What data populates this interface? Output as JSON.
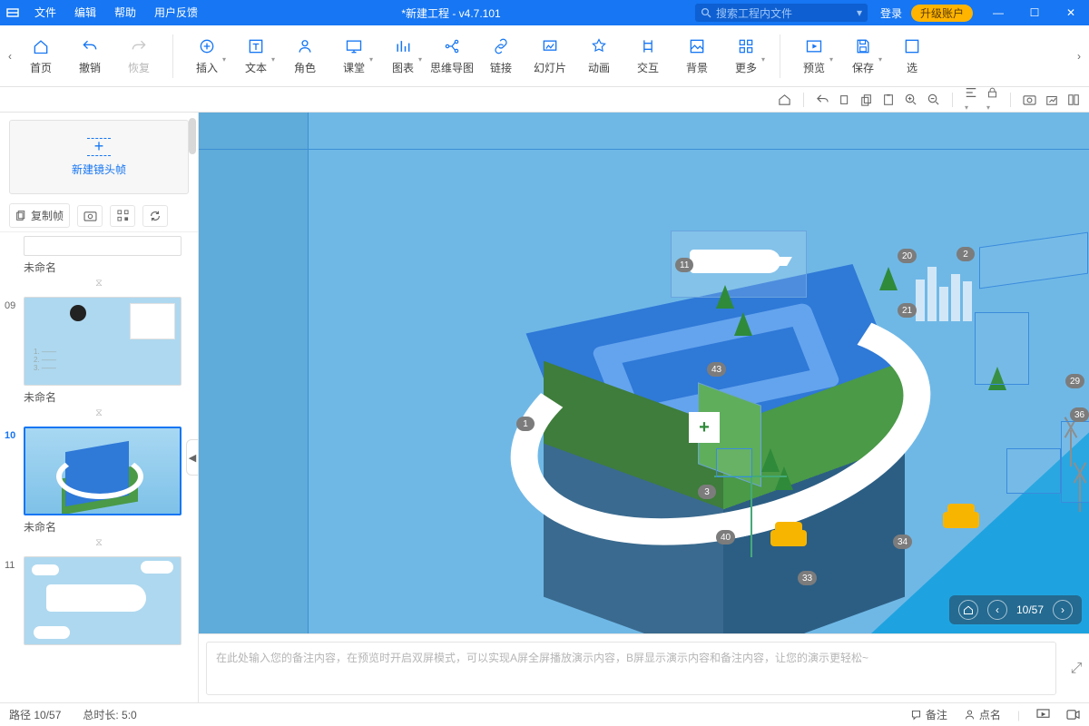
{
  "titlebar": {
    "menus": [
      "文件",
      "编辑",
      "帮助",
      "用户反馈"
    ],
    "title": "*新建工程 - v4.7.101",
    "search_placeholder": "搜索工程内文件",
    "login": "登录",
    "upgrade": "升级账户"
  },
  "ribbon": {
    "items": [
      {
        "id": "home",
        "label": "首页",
        "dropdown": false
      },
      {
        "id": "undo",
        "label": "撤销",
        "dropdown": false
      },
      {
        "id": "redo",
        "label": "恢复",
        "dropdown": false,
        "dim": true
      },
      {
        "sep": true
      },
      {
        "id": "insert",
        "label": "插入",
        "dropdown": true
      },
      {
        "id": "text",
        "label": "文本",
        "dropdown": true
      },
      {
        "id": "role",
        "label": "角色",
        "dropdown": false
      },
      {
        "id": "class",
        "label": "课堂",
        "dropdown": true
      },
      {
        "id": "chart",
        "label": "图表",
        "dropdown": true
      },
      {
        "id": "mind",
        "label": "思维导图",
        "dropdown": false
      },
      {
        "id": "link",
        "label": "链接",
        "dropdown": false
      },
      {
        "id": "slide",
        "label": "幻灯片",
        "dropdown": false
      },
      {
        "id": "anim",
        "label": "动画",
        "dropdown": false
      },
      {
        "id": "inter",
        "label": "交互",
        "dropdown": false
      },
      {
        "id": "bg",
        "label": "背景",
        "dropdown": false
      },
      {
        "id": "more",
        "label": "更多",
        "dropdown": true
      },
      {
        "sep": true
      },
      {
        "id": "preview",
        "label": "预览",
        "dropdown": true
      },
      {
        "id": "save",
        "label": "保存",
        "dropdown": true
      },
      {
        "id": "opt",
        "label": "选",
        "dropdown": false
      }
    ]
  },
  "canvasbar_icons": [
    "home-icon",
    "back-icon",
    "copy-icon",
    "paste-icon",
    "clipboard-icon",
    "zoom-in-icon",
    "zoom-out-icon",
    "align-icon",
    "lock-icon",
    "camera-icon",
    "grid-icon",
    "layout-icon"
  ],
  "sidebar": {
    "new_frame": "新建镜头帧",
    "copy_frame": "复制帧",
    "frames": [
      {
        "index": "",
        "name": "未命名",
        "thumb": "partial"
      },
      {
        "index": "09",
        "name": "未命名",
        "thumb": "desk"
      },
      {
        "index": "10",
        "name": "未命名",
        "thumb": "cube",
        "selected": true
      },
      {
        "index": "11",
        "name": "",
        "thumb": "plane"
      }
    ]
  },
  "canvas": {
    "badges": [
      "11",
      "20",
      "2",
      "21",
      "43",
      "1",
      "29",
      "36",
      "3",
      "40",
      "34",
      "33"
    ],
    "nav": {
      "counter": "10/57"
    }
  },
  "notes": {
    "placeholder": "在此处输入您的备注内容，在预览时开启双屏模式，可以实现A屏全屏播放演示内容，B屏显示演示内容和备注内容，让您的演示更轻松~"
  },
  "statusbar": {
    "path": "路径 10/57",
    "duration": "总时长: 5:0",
    "remark": "备注",
    "roll": "点名"
  }
}
